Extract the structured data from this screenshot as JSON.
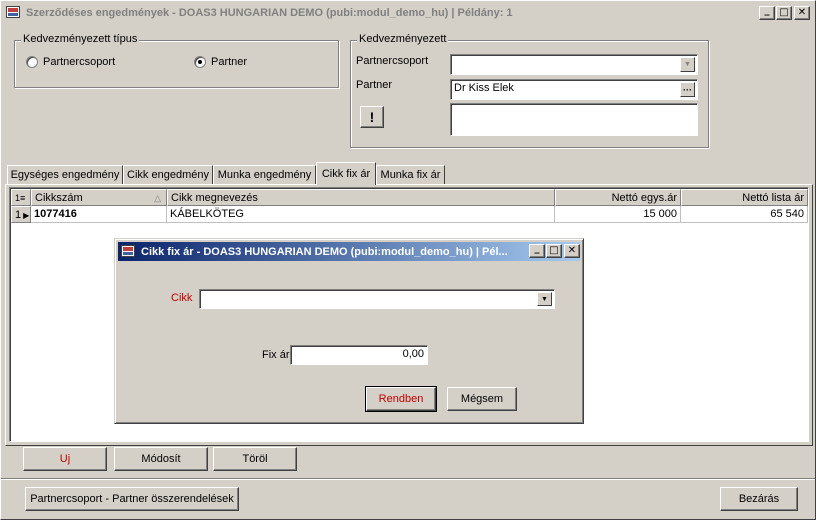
{
  "window": {
    "title": "Szerződéses engedmények - DOAS3 HUNGARIAN DEMO (pubi:modul_demo_hu) | Példány: 1",
    "minimize": "_",
    "maximize": "□",
    "close": "✕"
  },
  "type_group": {
    "label": "Kedvezményezett típus",
    "options": [
      {
        "label": "Partnercsoport",
        "selected": false
      },
      {
        "label": "Partner",
        "selected": true
      }
    ]
  },
  "beneficiary_group": {
    "label": "Kedvezményezett",
    "partnercsoport_label": "Partnercsoport",
    "partnercsoport_value": "",
    "partner_label": "Partner",
    "partner_value": "Dr Kiss Elek",
    "browse_button": "···",
    "info_button": "!"
  },
  "tabs": [
    {
      "label": "Egységes engedmény",
      "active": false
    },
    {
      "label": "Cikk engedmény",
      "active": false
    },
    {
      "label": "Munka engedmény",
      "active": false
    },
    {
      "label": "Cikk fix ár",
      "active": true
    },
    {
      "label": "Munka fix ár",
      "active": false
    }
  ],
  "grid": {
    "row_indicator_header": "1",
    "columns": [
      "Cikkszám",
      "Cikk megnevezés",
      "Nettó egys.ár",
      "Nettó lista ár"
    ],
    "sort_mark": "△",
    "rows": [
      {
        "num": "1",
        "cikkszam": "1077416",
        "megnevezes": "KÁBELKÖTEG",
        "netto_egys_ar": "15 000",
        "netto_lista_ar": "65 540"
      }
    ]
  },
  "grid_buttons": {
    "new": "Uj",
    "modify": "Módosít",
    "delete": "Töröl"
  },
  "bottom_buttons": {
    "assignments": "Partnercsoport - Partner összerendelések",
    "close": "Bezárás"
  },
  "dialog": {
    "title": "Cikk fix ár - DOAS3 HUNGARIAN DEMO (pubi:modul_demo_hu) | Pél...",
    "cikk_label": "Cikk",
    "cikk_value": "",
    "fix_ar_label": "Fix ár",
    "fix_ar_value": "0,00",
    "ok": "Rendben",
    "cancel": "Mégsem"
  },
  "colors": {
    "face": "#d4d0c8",
    "title_gradient_start": "#0a246a",
    "title_gradient_end": "#a6caf0",
    "mnemonic_red": "#c00000"
  }
}
